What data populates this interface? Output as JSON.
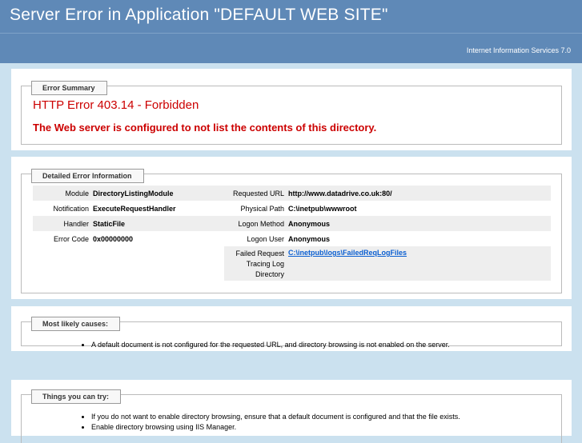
{
  "header": {
    "title": "Server Error in Application \"DEFAULT WEB SITE\"",
    "server_version": "Internet Information Services 7.0"
  },
  "error_summary": {
    "legend": "Error Summary",
    "code": "HTTP Error 403.14 - Forbidden",
    "message": "The Web server is configured to not list the contents of this directory."
  },
  "detailed": {
    "legend": "Detailed Error Information",
    "left": [
      {
        "label": "Module",
        "value": "DirectoryListingModule"
      },
      {
        "label": "Notification",
        "value": "ExecuteRequestHandler"
      },
      {
        "label": "Handler",
        "value": "StaticFile"
      },
      {
        "label": "Error Code",
        "value": "0x00000000"
      }
    ],
    "right": [
      {
        "label": "Requested URL",
        "value": "http://www.datadrive.co.uk:80/"
      },
      {
        "label": "Physical Path",
        "value": "C:\\inetpub\\wwwroot"
      },
      {
        "label": "Logon Method",
        "value": "Anonymous"
      },
      {
        "label": "Logon User",
        "value": "Anonymous"
      }
    ],
    "failed_request": {
      "label_line1": "Failed Request",
      "label_line2": "Tracing Log",
      "label_line3": "Directory",
      "value": "C:\\inetpub\\logs\\FailedReqLogFiles"
    }
  },
  "causes": {
    "legend": "Most likely causes:",
    "items": [
      "A default document is not configured for the requested URL, and directory browsing is not enabled on the server."
    ]
  },
  "try": {
    "legend": "Things you can try:",
    "items": [
      "If you do not want to enable directory browsing, ensure that a default document is configured and that the file exists.",
      "Enable directory browsing using IIS Manager."
    ]
  },
  "colors": {
    "header_bg": "#5f89b7",
    "page_bg": "#cbe1ef",
    "error_red": "#cc0000",
    "link_blue": "#0b5fd1"
  }
}
